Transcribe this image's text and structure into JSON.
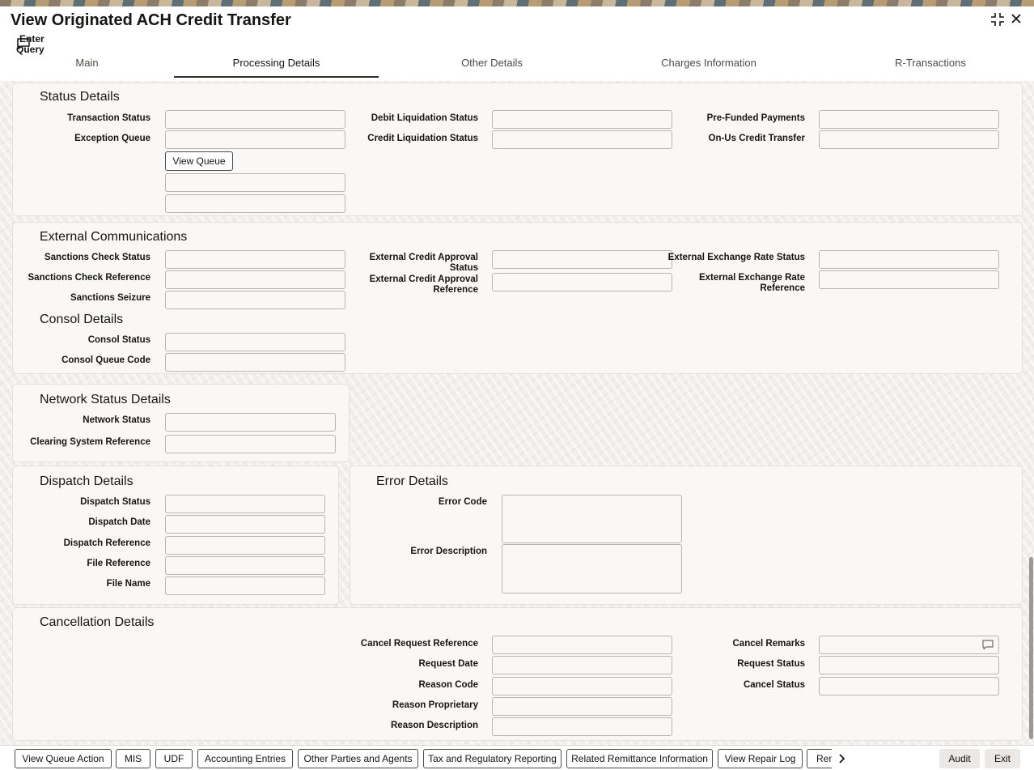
{
  "window": {
    "title": "View Originated ACH Credit Transfer",
    "minimize_icon": "collapse-icon",
    "close_icon": "close-icon"
  },
  "toolbar": {
    "enter_query_label": "Enter Query",
    "enter_query_icon": "comment-icon"
  },
  "tabs": [
    {
      "label": "Main",
      "active": false
    },
    {
      "label": "Processing Details",
      "active": true
    },
    {
      "label": "Other Details",
      "active": false
    },
    {
      "label": "Charges Information",
      "active": false
    },
    {
      "label": "R-Transactions",
      "active": false
    }
  ],
  "status_details": {
    "title": "Status Details",
    "transaction_status": "Transaction Status",
    "exception_queue": "Exception Queue",
    "view_queue_button": "View Queue",
    "debit_liquidation_status": "Debit Liquidation Status",
    "credit_liquidation_status": "Credit Liquidation Status",
    "pre_funded_payments": "Pre-Funded Payments",
    "on_us_credit_transfer": "On-Us Credit Transfer"
  },
  "external_communications": {
    "title": "External Communications",
    "sanctions_check_status": "Sanctions Check Status",
    "sanctions_check_reference": "Sanctions Check Reference",
    "sanctions_seizure": "Sanctions Seizure",
    "external_credit_approval_status_1": "External Credit Approval",
    "external_credit_approval_status_2": "Status",
    "external_credit_approval_reference_1": "External Credit Approval",
    "external_credit_approval_reference_2": "Reference",
    "external_exchange_rate_status": "External Exchange Rate Status",
    "external_exchange_rate_reference_1": "External Exchange Rate",
    "external_exchange_rate_reference_2": "Reference"
  },
  "consol_details": {
    "title": "Consol Details",
    "consol_status": "Consol Status",
    "consol_queue_code": "Consol Queue Code"
  },
  "network_status_details": {
    "title": "Network Status Details",
    "network_status": "Network Status",
    "clearing_system_reference": "Clearing System Reference"
  },
  "dispatch_details": {
    "title": "Dispatch Details",
    "dispatch_status": "Dispatch Status",
    "dispatch_date": "Dispatch Date",
    "dispatch_reference": "Dispatch Reference",
    "file_reference": "File Reference",
    "file_name": "File Name"
  },
  "error_details": {
    "title": "Error Details",
    "error_code": "Error Code",
    "error_description": "Error Description"
  },
  "cancellation_details": {
    "title": "Cancellation Details",
    "cancel_request_reference": "Cancel Request Reference",
    "request_date": "Request Date",
    "reason_code": "Reason Code",
    "reason_proprietary": "Reason Proprietary",
    "reason_description": "Reason Description",
    "cancel_remarks": "Cancel Remarks",
    "request_status": "Request Status",
    "cancel_status": "Cancel Status",
    "remarks_icon": "comment-icon"
  },
  "bottom_bar": {
    "buttons": [
      "View Queue Action",
      "MIS",
      "UDF",
      "Accounting Entries",
      "Other Parties and Agents",
      "Tax and Regulatory Reporting",
      "Related Remittance Information",
      "View Repair Log",
      "Rem"
    ],
    "more_icon": "chevron-right-icon",
    "audit_label": "Audit",
    "exit_label": "Exit"
  }
}
